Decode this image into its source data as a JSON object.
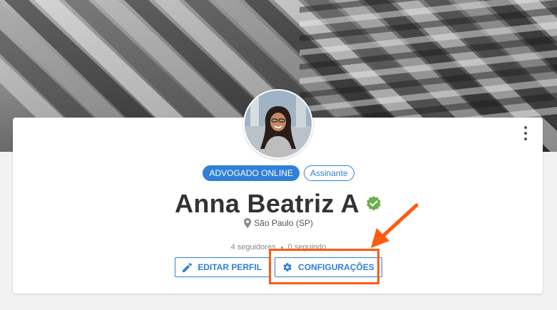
{
  "cover": {
    "icon": "abstract-architecture-photo"
  },
  "profile": {
    "avatar": "avatar-photo",
    "badges": [
      "ADVOGADO ONLINE",
      "Assinante"
    ],
    "name": "Anna Beatriz A",
    "verified_icon": "verified-check-icon",
    "location": "São Paulo (SP)",
    "followers": "4 seguidores",
    "following": "0 seguindo"
  },
  "actions": {
    "edit_label": "EDITAR PERFIL",
    "settings_label": "CONFIGURAÇÕES"
  },
  "menu": {
    "icon": "kebab-menu-icon"
  },
  "annotation": {
    "color": "#ff5a0f"
  },
  "colors": {
    "accent": "#2f80d7",
    "verified": "#6ab04c"
  }
}
